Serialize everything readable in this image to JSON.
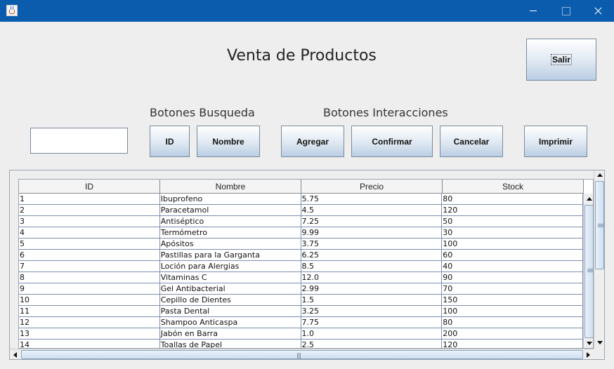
{
  "window": {
    "controls": [
      "minimize-icon",
      "maximize-icon",
      "close-icon"
    ]
  },
  "header": {
    "title": "Venta de Productos",
    "exit_label": "Salir"
  },
  "search": {
    "group_label": "Botones Busqueda",
    "value": "",
    "by_id_label": "ID",
    "by_name_label": "Nombre"
  },
  "actions": {
    "group_label": "Botones Interacciones",
    "add_label": "Agregar",
    "confirm_label": "Confirmar",
    "cancel_label": "Cancelar",
    "print_label": "Imprimir"
  },
  "table": {
    "columns": [
      "ID",
      "Nombre",
      "Precio",
      "Stock"
    ],
    "rows": [
      [
        "1",
        "Ibuprofeno",
        "5.75",
        "80"
      ],
      [
        "2",
        "Paracetamol",
        "4.5",
        "120"
      ],
      [
        "3",
        "Antiséptico",
        "7.25",
        "50"
      ],
      [
        "4",
        "Termómetro",
        "9.99",
        "30"
      ],
      [
        "5",
        "Apósitos",
        "3.75",
        "100"
      ],
      [
        "6",
        "Pastillas para la Garganta",
        "6.25",
        "60"
      ],
      [
        "7",
        "Loción para Alergias",
        "8.5",
        "40"
      ],
      [
        "8",
        "Vitaminas C",
        "12.0",
        "90"
      ],
      [
        "9",
        "Gel Antibacterial",
        "2.99",
        "70"
      ],
      [
        "10",
        "Cepillo de Dientes",
        "1.5",
        "150"
      ],
      [
        "11",
        "Pasta Dental",
        "3.25",
        "100"
      ],
      [
        "12",
        "Shampoo Anticaspa",
        "7.75",
        "80"
      ],
      [
        "13",
        "Jabón en Barra",
        "1.0",
        "200"
      ],
      [
        "14",
        "Toallas de Papel",
        "2.5",
        "120"
      ]
    ]
  },
  "colors": {
    "titlebar": "#0b5cad",
    "window_bg": "#eeeeee",
    "grid_line": "#7a8fb1"
  }
}
